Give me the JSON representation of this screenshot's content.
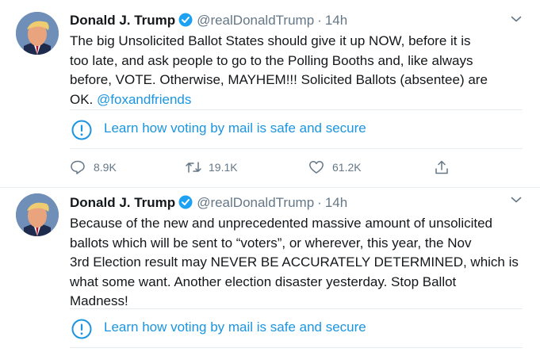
{
  "tweets": [
    {
      "author": "Donald J. Trump",
      "handle": "@realDonaldTrump",
      "separator": "·",
      "time": "14h",
      "verified_icon": "verified-badge-icon",
      "text_lines": [
        "The big Unsolicited Ballot States should give it up NOW, before it is",
        "too late, and ask people to go to the Polling Booths and, like always",
        "before, VOTE. Otherwise, MAYHEM!!! Solicited Ballots (absentee) are",
        "OK."
      ],
      "mention": "@foxandfriends",
      "notice": "Learn how voting by mail is safe and secure",
      "reply_count": "8.9K",
      "retweet_count": "19.1K",
      "like_count": "61.2K"
    },
    {
      "author": "Donald J. Trump",
      "handle": "@realDonaldTrump",
      "separator": "·",
      "time": "14h",
      "verified_icon": "verified-badge-icon",
      "text_lines": [
        "Because of the new and unprecedented massive amount of unsolicited",
        "ballots which will be sent to “voters”, or wherever, this year, the Nov",
        "3rd Election result may NEVER BE ACCURATELY DETERMINED, which is",
        "what some want. Another election disaster yesterday. Stop Ballot",
        "Madness!"
      ],
      "notice": "Learn how voting by mail is safe and secure"
    }
  ],
  "colors": {
    "accent": "#1b95e0",
    "text": "#14171a",
    "muted": "#657786",
    "divider": "#e6ecf0"
  },
  "icons": [
    "chevron-down-icon",
    "exclamation-circle-icon",
    "reply-icon",
    "retweet-icon",
    "heart-icon",
    "share-icon"
  ]
}
